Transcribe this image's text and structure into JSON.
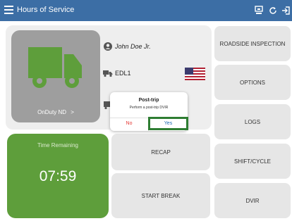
{
  "app": {
    "title": "Hours of Service"
  },
  "topbar": {
    "icons": [
      "menu-icon",
      "device-icon",
      "refresh-icon",
      "logout-icon"
    ]
  },
  "driver": {
    "name": "John Doe Jr.",
    "vehicle": "EDL1",
    "status": "OnDuty ND",
    "status_chevron": ">"
  },
  "time_remaining": {
    "label": "Time Remaining",
    "value": "07:59"
  },
  "right_buttons": [
    "ROADSIDE INSPECTION",
    "OPTIONS",
    "LOGS",
    "SHIFT/CYCLE",
    "DVIR"
  ],
  "mid_buttons": [
    "RECAP",
    "START BREAK"
  ],
  "dialog": {
    "title": "Post-trip",
    "message": "Perform a post-trip DVIR",
    "no_label": "No",
    "yes_label": "Yes"
  },
  "colors": {
    "header": "#3c6ea5",
    "truck": "#5e9e3b",
    "time_tile": "#5e9e3b",
    "dialog_highlight": "#2e7d32",
    "no": "#e53935",
    "yes": "#1e6ab4"
  }
}
